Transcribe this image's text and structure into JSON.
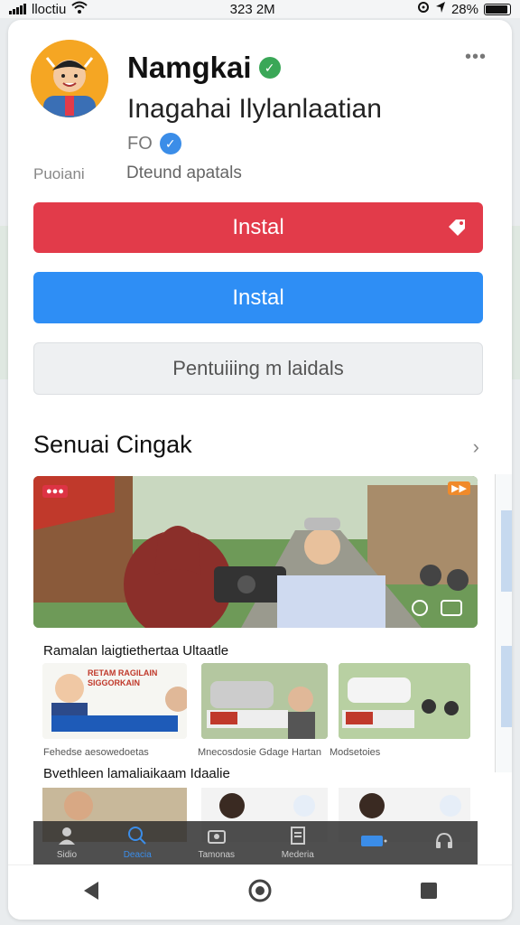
{
  "status_bar": {
    "carrier": "lloctiu",
    "time": "323 2M",
    "battery": "28%"
  },
  "app": {
    "name": "Namgkai",
    "developer": "Inagahai Ilylanlaatian",
    "meta": "FO",
    "info_left": "Puoiani",
    "info_right": "Dteund apatals"
  },
  "buttons": {
    "install_red": "Instal",
    "install_blue": "Instal",
    "secondary": "Pentuiiing m laidals"
  },
  "section": {
    "title": "Senuai Cingak"
  },
  "media": {
    "subtitle_1": "Ramalan laigtiethertaa Ultaatle",
    "thumb_captions": [
      "Fehedse aesowedoetas",
      "Mnecosdosie Gdage Hartan",
      "Modsetoies"
    ],
    "thumb_banners": [
      "RETAM RAGILAIN SIGGORKAIN",
      "",
      ""
    ],
    "subtitle_2": "Bvethleen lamaliaikaam Idaalie"
  },
  "tabs": [
    {
      "label": "Sidio",
      "icon": "person-icon"
    },
    {
      "label": "Deacia",
      "icon": "search-icon",
      "active": true
    },
    {
      "label": "Tamonas",
      "icon": "camera-icon"
    },
    {
      "label": "Mederia",
      "icon": "bookmark-icon"
    },
    {
      "label": "",
      "icon": "toggle-icon"
    },
    {
      "label": "",
      "icon": "headset-icon"
    }
  ],
  "colors": {
    "install_red": "#e23b4a",
    "install_blue": "#2e8ef5",
    "verified_green": "#3aa757",
    "verified_blue": "#3b8de8"
  }
}
